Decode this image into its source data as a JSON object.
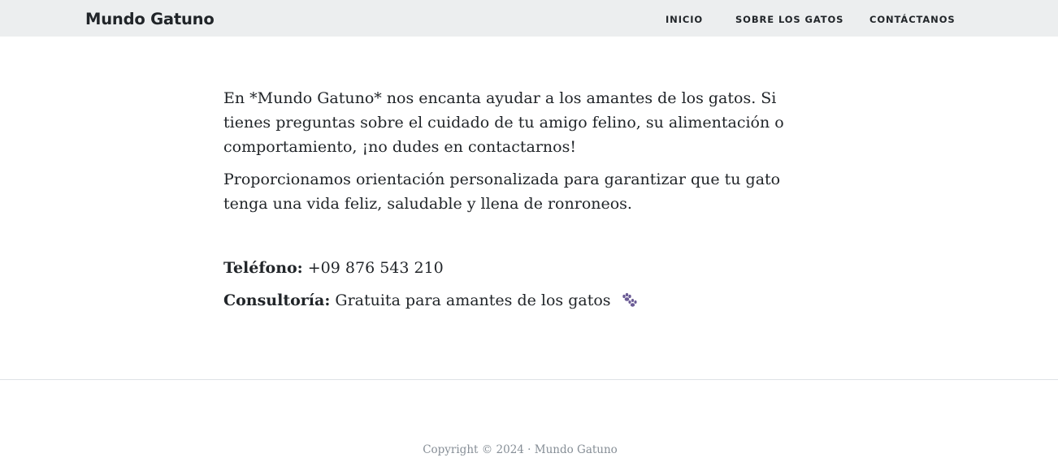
{
  "nav": {
    "brand": "Mundo Gatuno",
    "links": [
      "INICIO",
      "SOBRE LOS GATOS",
      "CONTÁCTANOS"
    ]
  },
  "main": {
    "paragraphs": [
      "En *Mundo Gatuno* nos encanta ayudar a los amantes de los gatos. Si tienes preguntas sobre el cuidado de tu amigo felino, su alimentación o comportamiento, ¡no dudes en contactarnos!",
      "Proporcionamos orientación personalizada para garantizar que tu gato tenga una vida feliz, saludable y llena de ronroneos."
    ],
    "contact": {
      "phone_label": "Teléfono:",
      "phone_value": "+09 876 543 210",
      "consult_label": "Consultoría:",
      "consult_value": "Gratuita para amantes de los gatos",
      "consult_icon": "paw-prints-icon"
    }
  },
  "footer": {
    "copyright": "Copyright © 2024 · Mundo Gatuno"
  },
  "colors": {
    "navbar_bg": "#eceeef",
    "text": "#212529",
    "footer_text": "#868e96",
    "paw": "#6b5b95"
  }
}
